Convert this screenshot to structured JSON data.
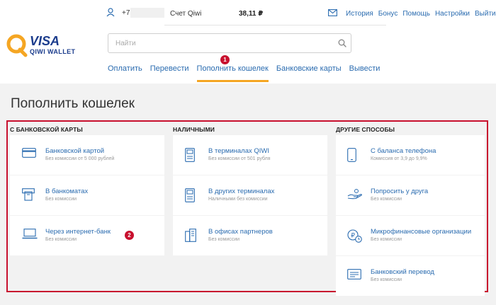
{
  "brand": {
    "visa": "VISA",
    "wallet": "QIWI WALLET"
  },
  "topbar": {
    "phone_prefix": "+7",
    "account_label": "Счет Qiwi",
    "balance": "38,11 ₽",
    "caret": "▾",
    "links": [
      "История",
      "Бонус",
      "Помощь",
      "Настройки",
      "Выйти"
    ]
  },
  "search": {
    "placeholder": "Найти",
    "value": ""
  },
  "badges": {
    "one": "1",
    "two": "2"
  },
  "nav": {
    "items": [
      "Оплатить",
      "Перевести",
      "Пополнить кошелек",
      "Банковские карты",
      "Вывести"
    ],
    "active": "Пополнить кошелек"
  },
  "page": {
    "title": "Пополнить кошелек"
  },
  "columns": [
    {
      "title": "С БАНКОВСКОЙ КАРТЫ",
      "items": [
        {
          "icon": "card-icon",
          "label": "Банковской картой",
          "sub": "Без комиссии от 5 000 рублей"
        },
        {
          "icon": "atm-icon",
          "label": "В банкоматах",
          "sub": "Без комиссии"
        },
        {
          "icon": "laptop-icon",
          "label": "Через интернет-банк",
          "sub": "Без комиссии"
        }
      ]
    },
    {
      "title": "НАЛИЧНЫМИ",
      "items": [
        {
          "icon": "terminal-icon",
          "label": "В терминалах QIWI",
          "sub": "Без комиссии от 501 рубля"
        },
        {
          "icon": "terminal-icon",
          "label": "В других терминалах",
          "sub": "Наличными без комиссии"
        },
        {
          "icon": "office-icon",
          "label": "В офисах партнеров",
          "sub": "Без комиссии"
        }
      ]
    },
    {
      "title": "ДРУГИЕ СПОСОБЫ",
      "items": [
        {
          "icon": "phone-icon",
          "label": "С баланса телефона",
          "sub": "Комиссия от 3,9 до 9,9%"
        },
        {
          "icon": "hand-icon",
          "label": "Попросить у друга",
          "sub": "Без комиссии"
        },
        {
          "icon": "coin-clock-icon",
          "label": "Микрофинансовые организации",
          "sub": "Без комиссии"
        },
        {
          "icon": "bank-transfer-icon",
          "label": "Банковский перевод",
          "sub": "Без комиссии"
        }
      ]
    }
  ],
  "colors": {
    "accent_blue": "#2b6cb0",
    "highlight_red": "#c8102e",
    "active_underline": "#f5a623"
  }
}
